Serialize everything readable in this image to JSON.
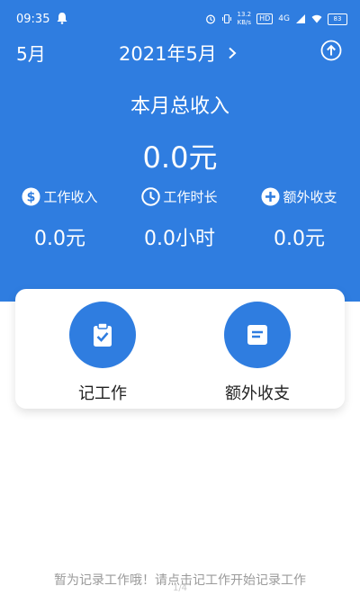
{
  "status_bar": {
    "time": "09:35",
    "speed_value": "13.2",
    "speed_unit": "KB/s",
    "hd": "HD",
    "network": "4G",
    "battery": "83"
  },
  "header": {
    "month_button": "5月",
    "current_date": "2021年5月"
  },
  "summary": {
    "total_label": "本月总收入",
    "total_value": "0.0元"
  },
  "stats": [
    {
      "label": "工作收入",
      "value": "0.0元",
      "icon": "dollar-icon"
    },
    {
      "label": "工作时长",
      "value": "0.0小时",
      "icon": "clock-icon"
    },
    {
      "label": "额外收支",
      "value": "0.0元",
      "icon": "plus-circle-icon"
    }
  ],
  "actions": [
    {
      "label": "记工作",
      "icon": "clipboard-check-icon"
    },
    {
      "label": "额外收支",
      "icon": "note-icon"
    }
  ],
  "empty_message": "暂为记录工作哦！请点击记工作开始记录工作",
  "pager": "1/4",
  "colors": {
    "primary": "#2f7de0",
    "card": "#ffffff",
    "hint": "#9a9a9a"
  }
}
